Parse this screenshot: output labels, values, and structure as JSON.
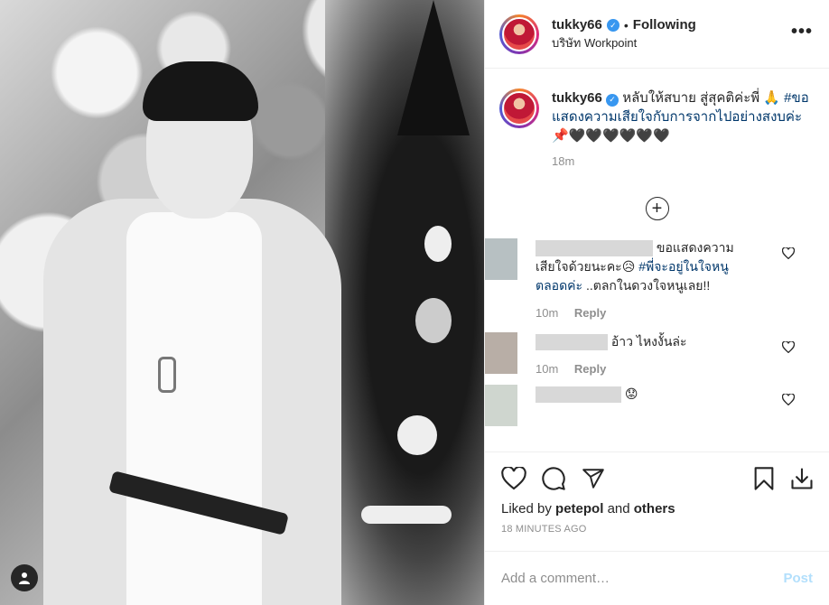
{
  "post": {
    "username": "tukky66",
    "follow_status": "Following",
    "separator": "•",
    "location": "บริษัท Workpoint"
  },
  "caption": {
    "username": "tukky66",
    "text": "หลับให้สบาย สู่สุคติค่ะพี่ 🙏",
    "hashtag": "#ขอแสดงความเสียใจกับการจากไปอย่างสงบค่ะ",
    "emojis": "📌🖤🖤🖤🖤🖤🖤",
    "time": "18m"
  },
  "comments": [
    {
      "text": "ขอแสดงความเสียใจด้วยนะคะ😥",
      "hashtag": "#พี่จะอยู่ในใจหนูตลอดค่ะ",
      "text2": "..ตลกในดวงใจหนูเลย!!",
      "time": "10m",
      "reply": "Reply",
      "avatar_color": "#b7c0c2"
    },
    {
      "text": "อ้าว ไหงงั้นล่ะ",
      "time": "10m",
      "reply": "Reply",
      "avatar_color": "#b8aea6"
    },
    {
      "text": "😟",
      "avatar_color": "#cfd6cf"
    }
  ],
  "actions": {
    "liked_prefix": "Liked by",
    "liked_user": "petepol",
    "liked_and": "and",
    "liked_others": "others",
    "timestamp": "18 MINUTES AGO"
  },
  "add_comment": {
    "placeholder": "Add a comment…",
    "post_label": "Post"
  },
  "icons": {
    "verified": "verified-badge-icon",
    "more": "more-options-icon",
    "load_more": "plus-circle-icon",
    "like": "heart-icon",
    "comment": "comment-bubble-icon",
    "share": "paper-plane-icon",
    "save": "bookmark-icon",
    "download": "download-icon",
    "user_tag": "user-tag-icon"
  },
  "colors": {
    "hashtag": "#00376b",
    "verified": "#3897f0",
    "post_disabled": "#b2dffc",
    "meta": "#8e8e8e"
  }
}
